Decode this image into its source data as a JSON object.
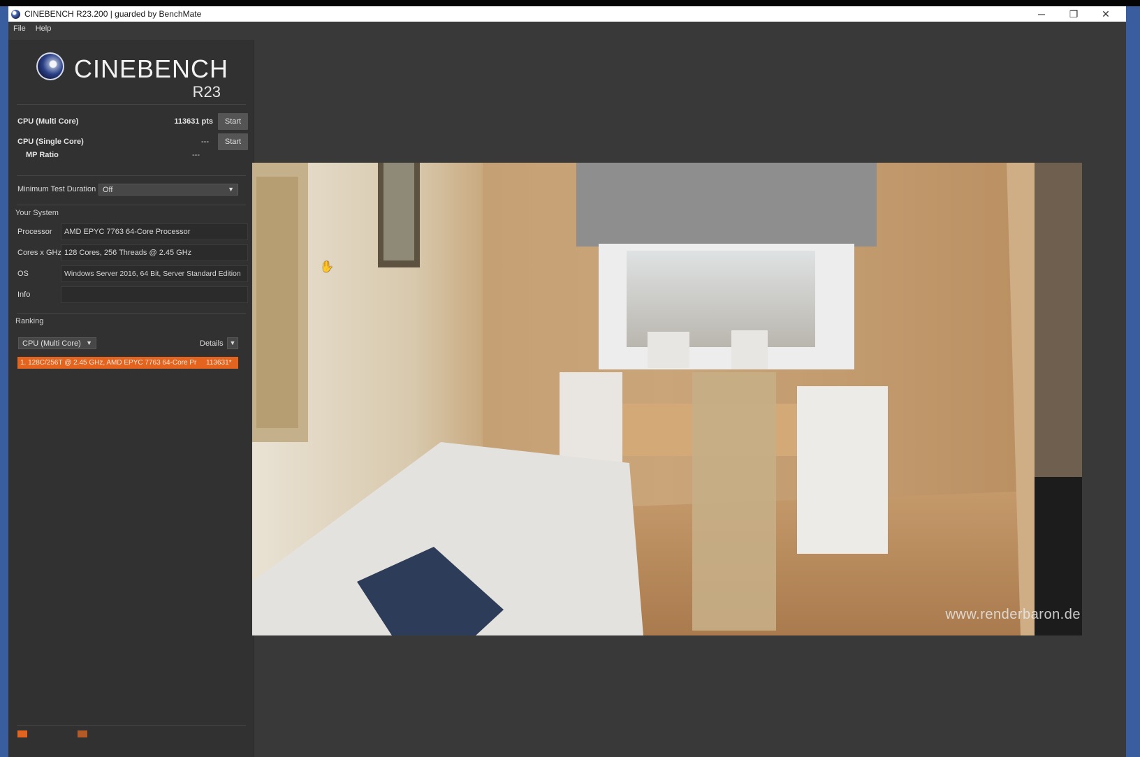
{
  "window": {
    "title": "CINEBENCH R23.200 | guarded by BenchMate",
    "controls": {
      "minimize": "─",
      "restore": "❐",
      "close": "✕"
    }
  },
  "menu": {
    "file": "File",
    "help": "Help"
  },
  "logo": {
    "name": "CINEBENCH",
    "version": "R23"
  },
  "benchmarks": {
    "multi": {
      "label": "CPU (Multi Core)",
      "score": "113631 pts",
      "button": "Start"
    },
    "single": {
      "label": "CPU (Single Core)",
      "score": "---",
      "button": "Start"
    },
    "mp_ratio": {
      "label": "MP Ratio",
      "value": "---"
    }
  },
  "duration": {
    "label": "Minimum Test Duration",
    "value": "Off"
  },
  "system": {
    "title": "Your System",
    "processor": {
      "label": "Processor",
      "value": "AMD EPYC 7763 64-Core Processor"
    },
    "cores": {
      "label": "Cores x GHz",
      "value": "128 Cores, 256 Threads @ 2.45 GHz"
    },
    "os": {
      "label": "OS",
      "value": "Windows Server 2016, 64 Bit, Server Standard Edition"
    },
    "info": {
      "label": "Info",
      "value": ""
    }
  },
  "ranking": {
    "title": "Ranking",
    "select_value": "CPU (Multi Core)",
    "details_label": "Details",
    "entries": [
      {
        "text": "1. 128C/256T @ 2.45 GHz, AMD EPYC 7763 64-Core Pr",
        "score": "113631*"
      }
    ]
  },
  "render": {
    "watermark": "www.renderbaron.de"
  },
  "icons": {
    "app": "cinebench-app-icon",
    "chevron": "chevron-down-icon",
    "cursor": "hand-cursor-icon"
  },
  "colors": {
    "accent": "#e2641f",
    "panel": "#313131",
    "window": "#393939",
    "desktop": "#3a5da0"
  }
}
